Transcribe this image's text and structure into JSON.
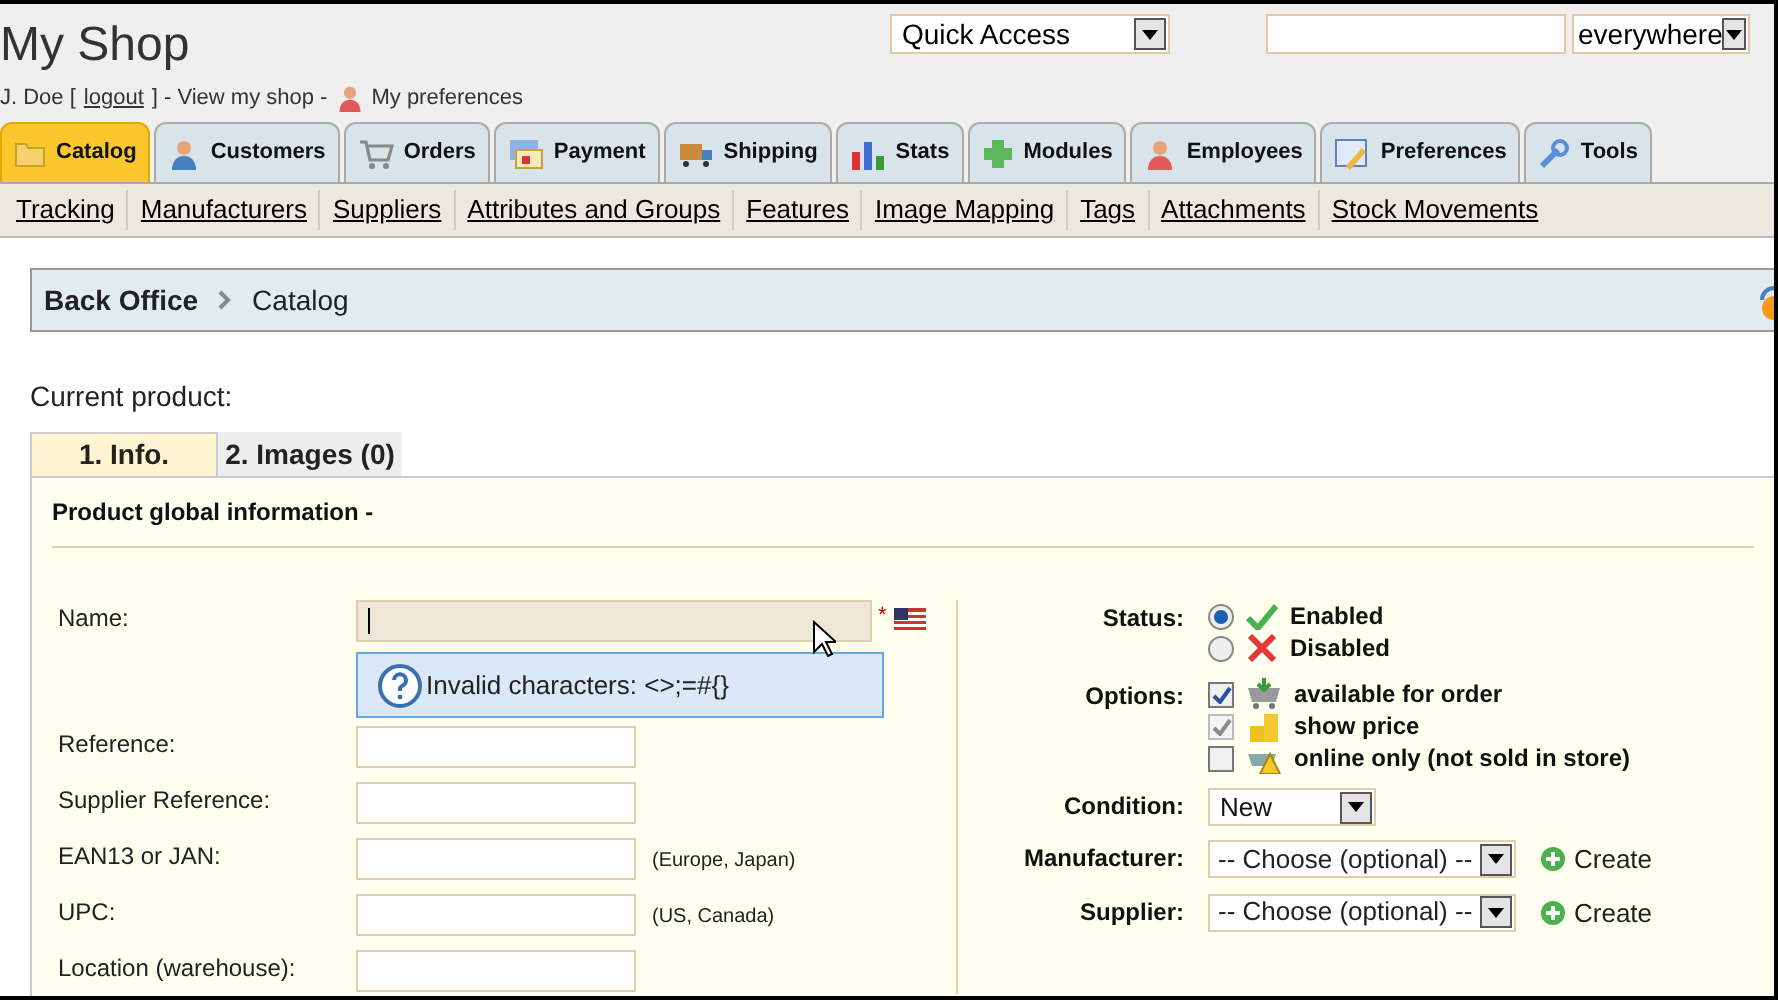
{
  "header": {
    "title": "My Shop",
    "user": "J. Doe [",
    "logout": "logout",
    "view_shop": "] - View my shop -",
    "preferences": "My preferences"
  },
  "quick_access": {
    "value": "Quick Access"
  },
  "search_scope": {
    "value": "everywhere"
  },
  "main_tabs": [
    {
      "label": "Catalog",
      "selected": true
    },
    {
      "label": "Customers",
      "selected": false
    },
    {
      "label": "Orders",
      "selected": false
    },
    {
      "label": "Payment",
      "selected": false
    },
    {
      "label": "Shipping",
      "selected": false
    },
    {
      "label": "Stats",
      "selected": false
    },
    {
      "label": "Modules",
      "selected": false
    },
    {
      "label": "Employees",
      "selected": false
    },
    {
      "label": "Preferences",
      "selected": false
    },
    {
      "label": "Tools",
      "selected": false
    }
  ],
  "sub_nav": [
    "Tracking",
    "Manufacturers",
    "Suppliers",
    "Attributes and Groups",
    "Features",
    "Image Mapping",
    "Tags",
    "Attachments",
    "Stock Movements"
  ],
  "breadcrumb": [
    "Back Office",
    "Catalog"
  ],
  "current_product": "Current product:",
  "product_tabs": [
    {
      "label": "1. Info.",
      "selected": true
    },
    {
      "label": "2. Images (0)",
      "selected": false
    }
  ],
  "section_title": "Product global information -",
  "name_field": {
    "label": "Name:",
    "required": "*",
    "tooltip": "Invalid characters: <>;=#{}"
  },
  "fields": [
    {
      "label": "Reference:"
    },
    {
      "label": "Supplier Reference:"
    },
    {
      "label": "EAN13 or JAN:",
      "note": "(Europe, Japan)"
    },
    {
      "label": "UPC:",
      "note": "(US, Canada)"
    },
    {
      "label": "Location (warehouse):"
    }
  ],
  "status": {
    "label": "Status:",
    "options": [
      {
        "label": "Enabled",
        "selected": true
      },
      {
        "label": "Disabled",
        "selected": false
      }
    ]
  },
  "options": {
    "label": "Options:",
    "items": [
      {
        "label": "available for order",
        "checked": true,
        "disabled": false
      },
      {
        "label": "show price",
        "checked": true,
        "disabled": true
      },
      {
        "label": "online only (not sold in store)",
        "checked": false,
        "disabled": false
      }
    ]
  },
  "condition": {
    "label": "Condition:",
    "value": "New"
  },
  "selects": [
    {
      "label": "Manufacturer:",
      "value": "-- Choose (optional) --",
      "create": "Create"
    },
    {
      "label": "Supplier:",
      "value": "-- Choose (optional) --",
      "create": "Create"
    }
  ]
}
